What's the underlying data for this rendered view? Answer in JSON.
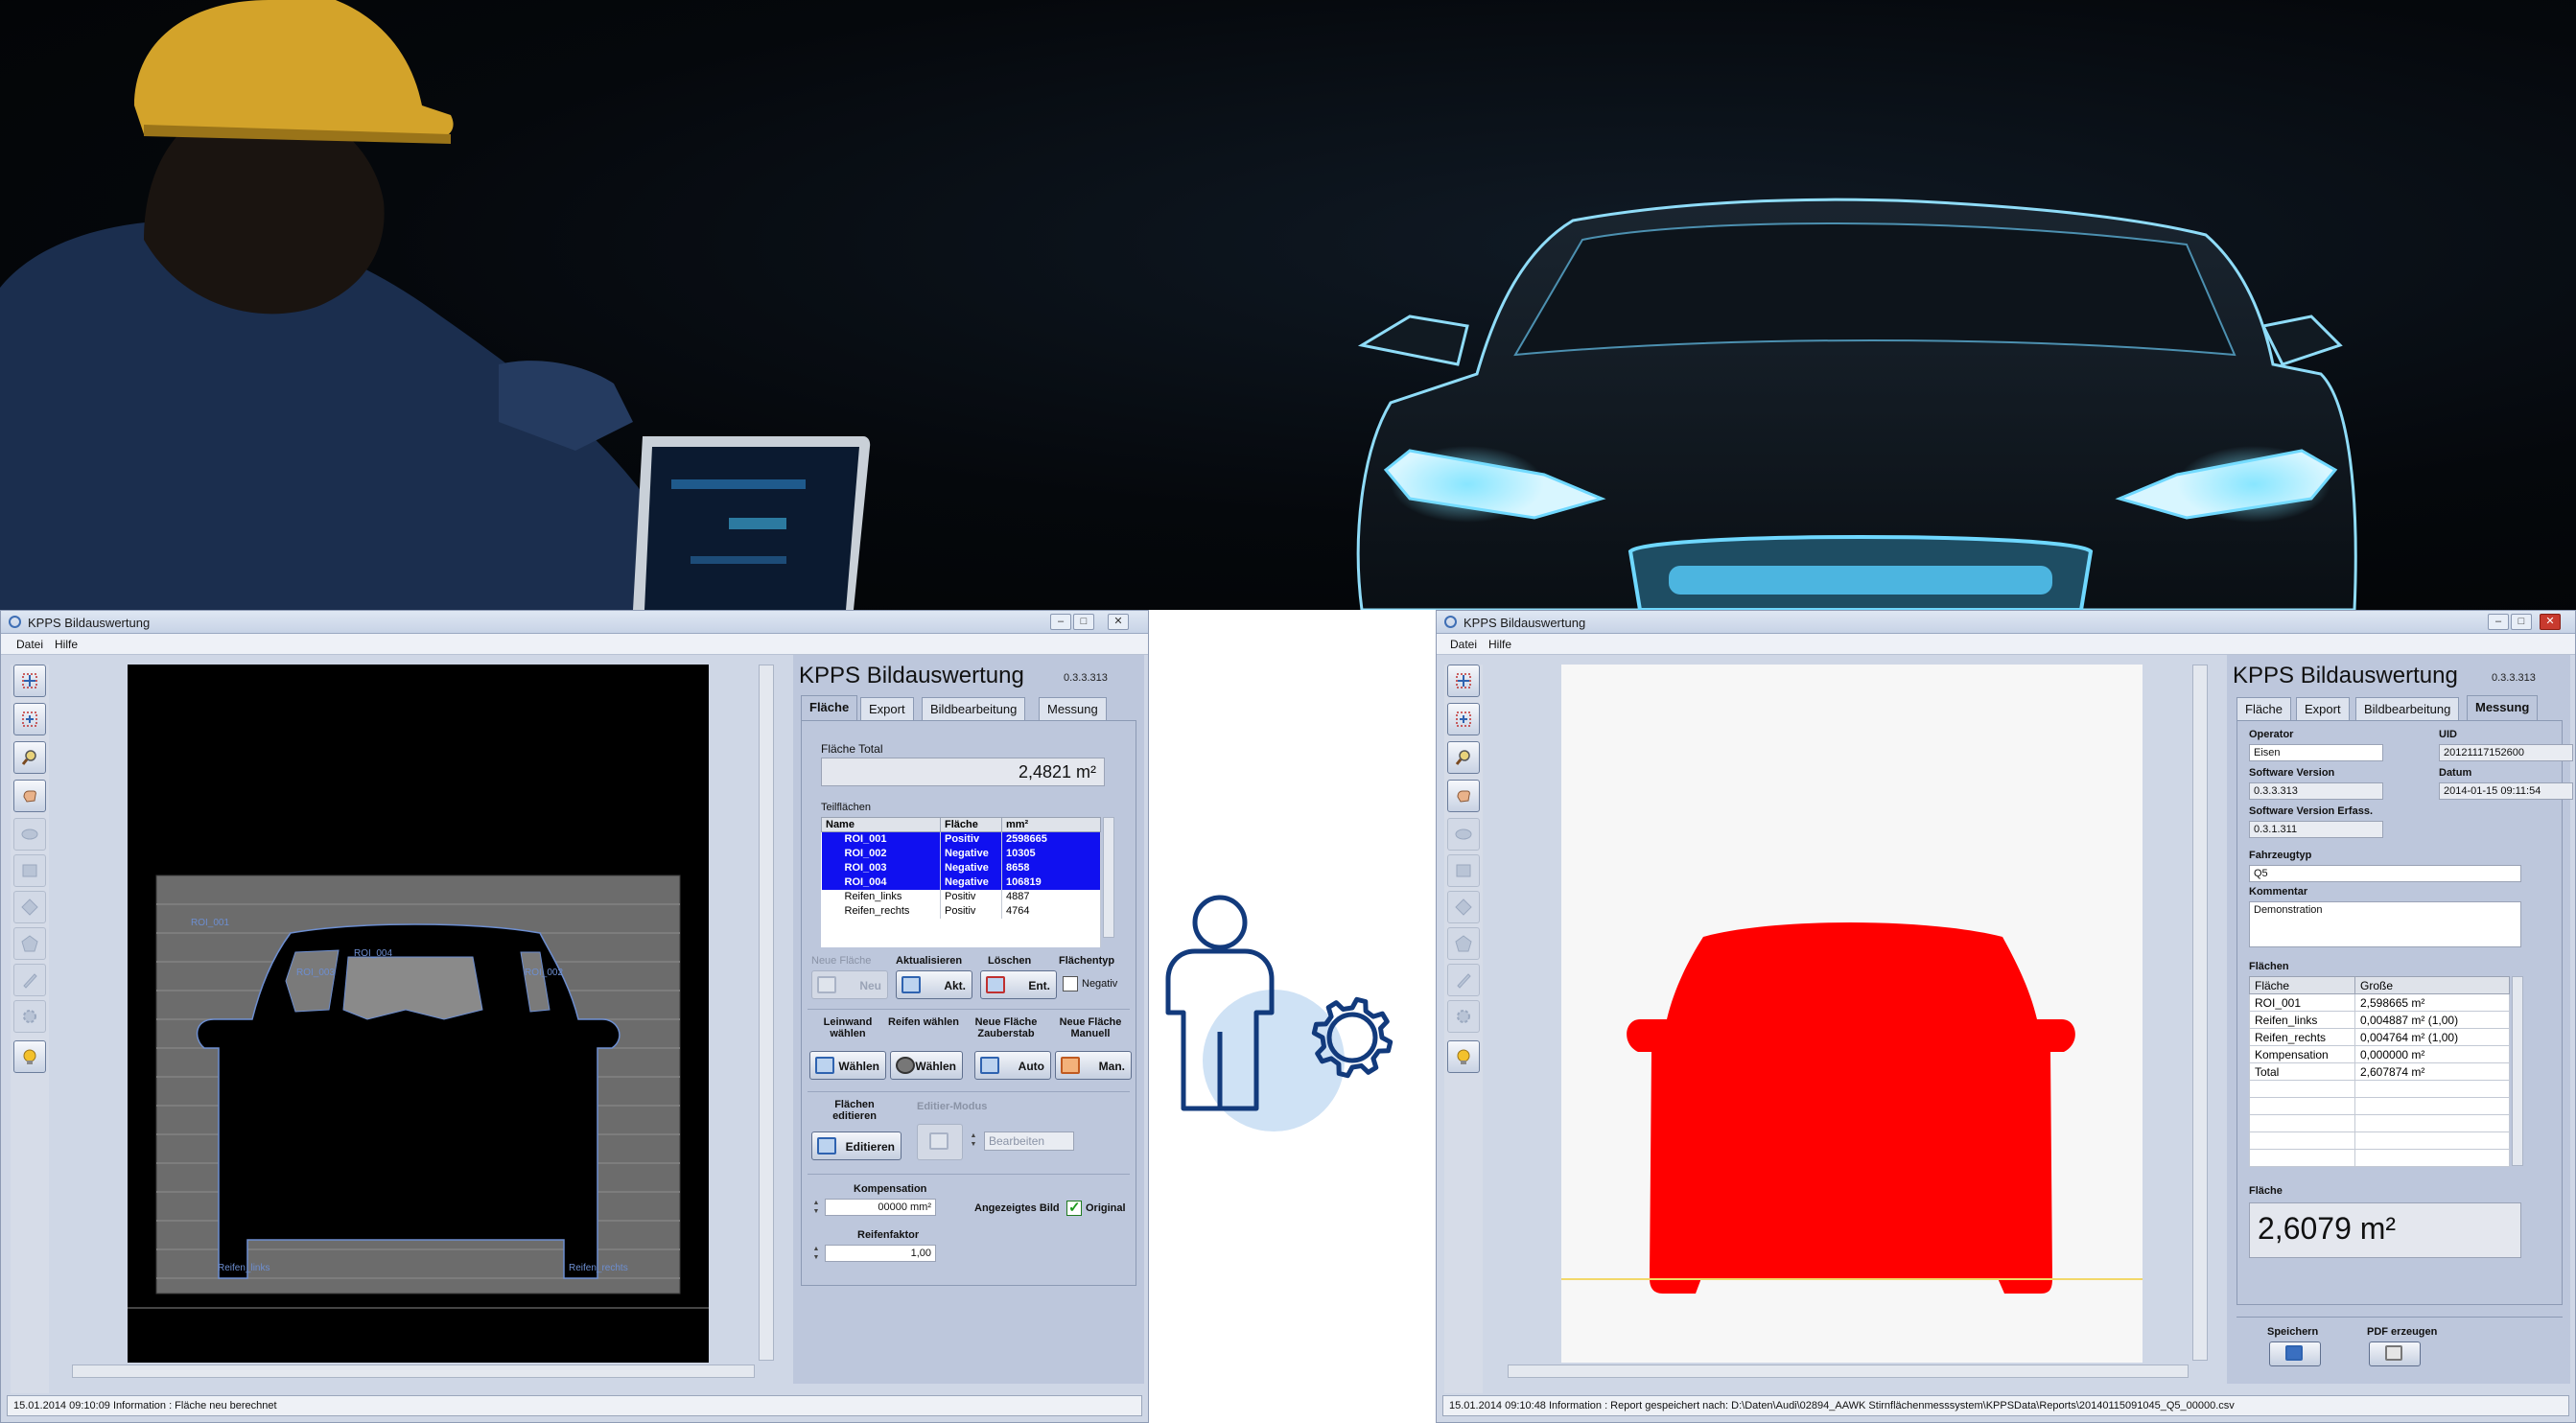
{
  "colors": {
    "accent_blue": "#1010f0",
    "shape_red": "#ff0000",
    "icon_navy": "#123a7c",
    "icon_bubble": "#cfe2f5",
    "window_bg": "#cfd7e6"
  },
  "left_window": {
    "title": "KPPS Bildauswertung",
    "menu": [
      "Datei",
      "Hilfe"
    ],
    "panel_title": "KPPS Bildauswertung",
    "version": "0.3.3.313",
    "tabs": [
      "Fläche",
      "Export",
      "Bildbearbeitung",
      "Messung"
    ],
    "active_tab": "Fläche",
    "flaeche_total_label": "Fläche Total",
    "flaeche_total_value": "2,4821 m²",
    "teilflaechen_label": "Teilflächen",
    "table_headers": [
      "Name",
      "Fläche",
      "mm²"
    ],
    "table_rows": [
      {
        "name": "ROI_001",
        "type": "Positiv",
        "value": "2598665",
        "selected": true
      },
      {
        "name": "ROI_002",
        "type": "Negative",
        "value": "10305",
        "selected": true
      },
      {
        "name": "ROI_003",
        "type": "Negative",
        "value": "8658",
        "selected": true
      },
      {
        "name": "ROI_004",
        "type": "Negative",
        "value": "106819",
        "selected": true
      },
      {
        "name": "Reifen_links",
        "type": "Positiv",
        "value": "4887",
        "selected": false
      },
      {
        "name": "Reifen_rechts",
        "type": "Positiv",
        "value": "4764",
        "selected": false
      }
    ],
    "row1_labels": {
      "neue_flaeche": "Neue Fläche",
      "aktualisieren": "Aktualisieren",
      "loeschen": "Löschen",
      "flaechentyp": "Flächentyp"
    },
    "row1_buttons": {
      "neu": "Neu",
      "akt": "Akt.",
      "ent": "Ent."
    },
    "negativ_label": "Negativ",
    "row2_labels": {
      "leinwand": "Leinwand wählen",
      "reifen": "Reifen wählen",
      "zauberstab": "Neue Fläche Zauberstab",
      "manuell": "Neue Fläche Manuell"
    },
    "row2_buttons": {
      "waehlen1": "Wählen",
      "waehlen2": "Wählen",
      "auto": "Auto",
      "man": "Man."
    },
    "flaechen_editieren_label": "Flächen editieren",
    "editieren_button": "Editieren",
    "editier_modus_label": "Editier-Modus",
    "bearbeiten_value": "Bearbeiten",
    "kompensation_label": "Kompensation",
    "kompensation_value": "00000 mm²",
    "angezeigtes_bild_label": "Angezeigtes Bild",
    "original_label": "Original",
    "reifenfaktor_label": "Reifenfaktor",
    "reifenfaktor_value": "1,00",
    "canvas_labels": {
      "roi_001": "ROI_001",
      "roi_002": "ROI_002",
      "roi_003": "ROI_003",
      "roi_004": "ROI_004",
      "reifen_links": "Reifen_links",
      "reifen_rechts": "Reifen_rechts"
    },
    "status": "15.01.2014 09:10:09 Information : Fläche neu berechnet"
  },
  "right_window": {
    "title": "KPPS Bildauswertung",
    "menu": [
      "Datei",
      "Hilfe"
    ],
    "panel_title": "KPPS Bildauswertung",
    "version": "0.3.3.313",
    "tabs": [
      "Fläche",
      "Export",
      "Bildbearbeitung",
      "Messung"
    ],
    "active_tab": "Messung",
    "operator_label": "Operator",
    "operator_value": "Eisen",
    "uid_label": "UID",
    "uid_value": "20121117152600",
    "software_version_label": "Software Version",
    "software_version_value": "0.3.3.313",
    "datum_label": "Datum",
    "datum_value": "2014-01-15 09:11:54",
    "software_version_erfass_label": "Software Version Erfass.",
    "software_version_erfass_value": "0.3.1.311",
    "fahrzeugtyp_label": "Fahrzeugtyp",
    "fahrzeugtyp_value": "Q5",
    "kommentar_label": "Kommentar",
    "kommentar_value": "Demonstration",
    "flaechen_label": "Flächen",
    "table_headers": [
      "Fläche",
      "Große"
    ],
    "table_rows": [
      {
        "name": "ROI_001",
        "value": "2,598665 m²"
      },
      {
        "name": "Reifen_links",
        "value": "0,004887 m² (1,00)"
      },
      {
        "name": "Reifen_rechts",
        "value": "0,004764 m² (1,00)"
      },
      {
        "name": "Kompensation",
        "value": "0,000000 m²"
      },
      {
        "name": "Total",
        "value": "2,607874 m²"
      }
    ],
    "flaeche_label": "Fläche",
    "flaeche_value": "2,6079 m²",
    "speichern_label": "Speichern",
    "pdf_label": "PDF erzeugen",
    "status": "15.01.2014 09:10:48 Information : Report gespeichert nach: D:\\Daten\\Audi\\02894_AAWK Stirnflächenmesssystem\\KPPSData\\Reports\\20140115091045_Q5_00000.csv"
  },
  "icons": {
    "center": [
      "person-icon",
      "gear-icon"
    ],
    "toolbar": [
      "zoom-fit-icon",
      "zoom-reset-icon",
      "magnifier-icon",
      "pan-hand-icon",
      "ellipse-icon",
      "rectangle-icon",
      "diamond-icon",
      "pentagon-icon",
      "pen-icon",
      "gear-icon",
      "bulb-icon"
    ]
  }
}
